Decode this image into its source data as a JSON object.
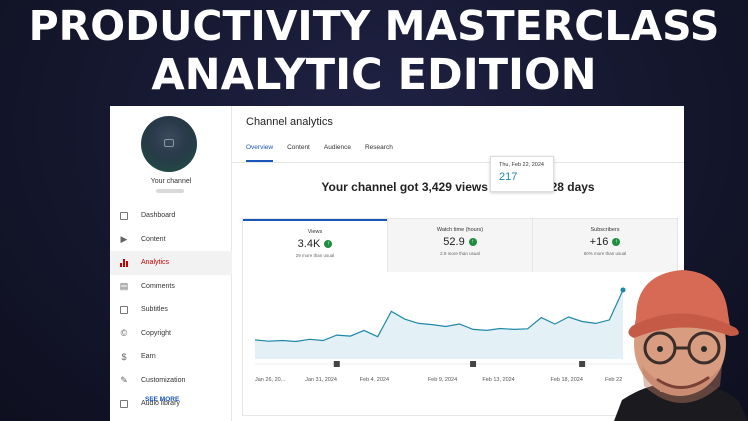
{
  "headline": {
    "line1": "PRODUCTIVITY MASTERCLASS",
    "line2": "ANALYTIC EDITION"
  },
  "sidebar": {
    "channel_label": "Your channel",
    "items": [
      {
        "label": "Dashboard",
        "icon": "dashboard-icon"
      },
      {
        "label": "Content",
        "icon": "content-icon"
      },
      {
        "label": "Analytics",
        "icon": "analytics-icon",
        "active": true
      },
      {
        "label": "Comments",
        "icon": "comments-icon"
      },
      {
        "label": "Subtitles",
        "icon": "subtitles-icon"
      },
      {
        "label": "Copyright",
        "icon": "copyright-icon"
      },
      {
        "label": "Earn",
        "icon": "earn-icon"
      },
      {
        "label": "Customization",
        "icon": "customization-icon"
      },
      {
        "label": "Audio library",
        "icon": "audio-library-icon"
      }
    ]
  },
  "main": {
    "title": "Channel analytics",
    "tabs": [
      "Overview",
      "Content",
      "Audience",
      "Research"
    ],
    "summary": "Your channel got 3,429 views in the last 28 days",
    "metrics": [
      {
        "label": "Views",
        "value": "3.4K",
        "note": "29 more than usual"
      },
      {
        "label": "Watch time (hours)",
        "value": "52.9",
        "note": "2.9 more than usual"
      },
      {
        "label": "Subscribers",
        "value": "+16",
        "note": "60% more than usual"
      }
    ],
    "see_more": "SEE MORE"
  },
  "tooltip": {
    "date": "Thu, Feb 22, 2024",
    "value": "217"
  },
  "colors": {
    "accent_blue": "#1a56b8",
    "active_red": "#cc0000",
    "line_blue": "#1e88a8",
    "positive_green": "#1e8e3e"
  },
  "chart_data": {
    "type": "area",
    "x": [
      "Jan 26, 2024",
      "Jan 27",
      "Jan 28",
      "Jan 29",
      "Jan 30",
      "Jan 31, 2024",
      "Feb 1",
      "Feb 2",
      "Feb 3",
      "Feb 4, 2024",
      "Feb 5",
      "Feb 6",
      "Feb 7",
      "Feb 8",
      "Feb 9, 2024",
      "Feb 10",
      "Feb 11",
      "Feb 12",
      "Feb 13, 2024",
      "Feb 14",
      "Feb 15",
      "Feb 16",
      "Feb 17",
      "Feb 18, 2024",
      "Feb 19",
      "Feb 20",
      "Feb 21",
      "Feb 22"
    ],
    "tick_labels": [
      "Jan 26, 20...",
      "Jan 31, 2024",
      "Feb 4, 2024",
      "Feb 9, 2024",
      "Feb 13, 2024",
      "Feb 18, 2024",
      "Feb 22"
    ],
    "tick_indices": [
      0,
      5,
      9,
      14,
      18,
      23,
      27
    ],
    "series": [
      {
        "values": [
          60,
          56,
          58,
          55,
          62,
          58,
          75,
          72,
          90,
          70,
          150,
          125,
          112,
          108,
          102,
          110,
          93,
          90,
          96,
          93,
          95,
          130,
          110,
          132,
          118,
          112,
          123,
          217
        ]
      }
    ],
    "ylim": [
      0,
      220
    ],
    "grid": false,
    "markers_at": [
      6,
      16,
      24
    ]
  }
}
